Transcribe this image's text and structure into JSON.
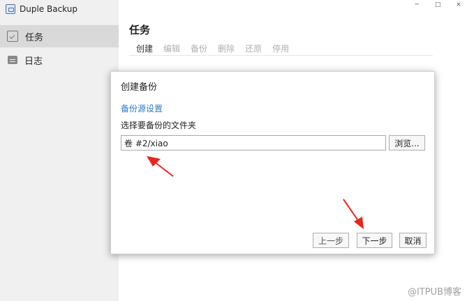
{
  "app": {
    "title": "Duple Backup"
  },
  "window_controls": {
    "minimize": "─",
    "maximize": "□",
    "close": "×"
  },
  "sidebar": {
    "items": [
      {
        "label": "任务",
        "icon": "task-icon",
        "active": true
      },
      {
        "label": "日志",
        "icon": "log-icon",
        "active": false
      }
    ]
  },
  "main": {
    "title": "任务",
    "toolbar": [
      {
        "label": "创建",
        "enabled": true
      },
      {
        "label": "编辑",
        "enabled": false
      },
      {
        "label": "备份",
        "enabled": false
      },
      {
        "label": "删除",
        "enabled": false
      },
      {
        "label": "还原",
        "enabled": false
      },
      {
        "label": "停用",
        "enabled": false
      }
    ]
  },
  "dialog": {
    "title": "创建备份",
    "section_title": "备份源设置",
    "description": "选择要备份的文件夹",
    "path_value": "卷 #2/xiao",
    "browse_label": "浏览...",
    "prev_label": "上一步",
    "next_label": "下一步",
    "cancel_label": "取消"
  },
  "annotations": {
    "arrow_color": "#e8261c"
  },
  "watermark": "@ITPUB博客"
}
